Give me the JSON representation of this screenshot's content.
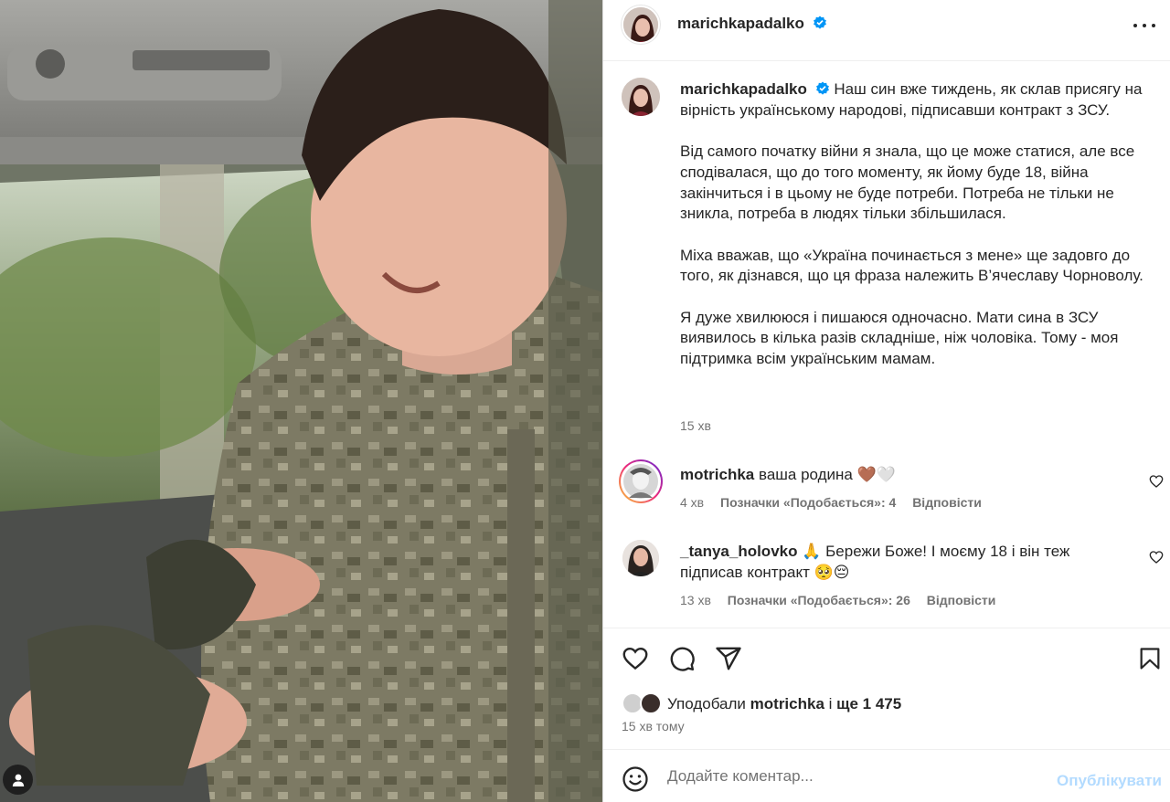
{
  "post": {
    "author": "marichkapadalko",
    "caption": {
      "author": "marichkapadalko",
      "lead": "Наш син вже тиждень, як склав присягу на вірність українському народові, підписавши контракт з ЗСУ.",
      "p2": "Від самого початку війни я знала, що це може статися, але все сподівалася, що до того моменту, як йому буде 18, війна закінчиться і в цьому не буде потреби. Потреба не тільки не зникла, потреба в людях тільки збільшилася.",
      "p3": "Міха вважав, що «Україна починається з мене» ще задовго до того, як дізнався, що ця фраза належить В’ячеславу Чорноволу.",
      "p4": "Я дуже хвилююся і пишаюся одночасно. Мати сина в ЗСУ виявилось в кілька разів складніше, ніж чоловіка. Тому - моя підтримка всім українським мамам.",
      "time": "15 хв"
    },
    "comments": [
      {
        "user": "motrichka",
        "text": "ваша родина 🤎🤍",
        "time": "4 хв",
        "likes": "Позначки «Подобається»: 4",
        "reply": "Відповісти"
      },
      {
        "user": "_tanya_holovko",
        "text": "🙏 Бережи Боже! І моєму 18 і він теж підписав контракт 🥺😔",
        "time": "13 хв",
        "likes": "Позначки «Подобається»: 26",
        "reply": "Відповісти"
      }
    ],
    "likes": {
      "prefix": "Уподобали",
      "user": "motrichka",
      "middle": "і",
      "count": "ще 1 475"
    },
    "posted": "15 хв тому",
    "add_comment": {
      "placeholder": "Додайте коментар...",
      "publish": "Опублікувати"
    }
  },
  "icons": {
    "verified": "verified-badge-icon",
    "more": "more-options-icon",
    "like": "heart-icon",
    "comment": "comment-icon",
    "share": "share-icon",
    "save": "bookmark-icon",
    "emoji": "emoji-icon",
    "tags": "user-tags-icon"
  },
  "colors": {
    "verified": "#0095f6",
    "publish_disabled": "#b3dbff",
    "meta": "#737373"
  }
}
